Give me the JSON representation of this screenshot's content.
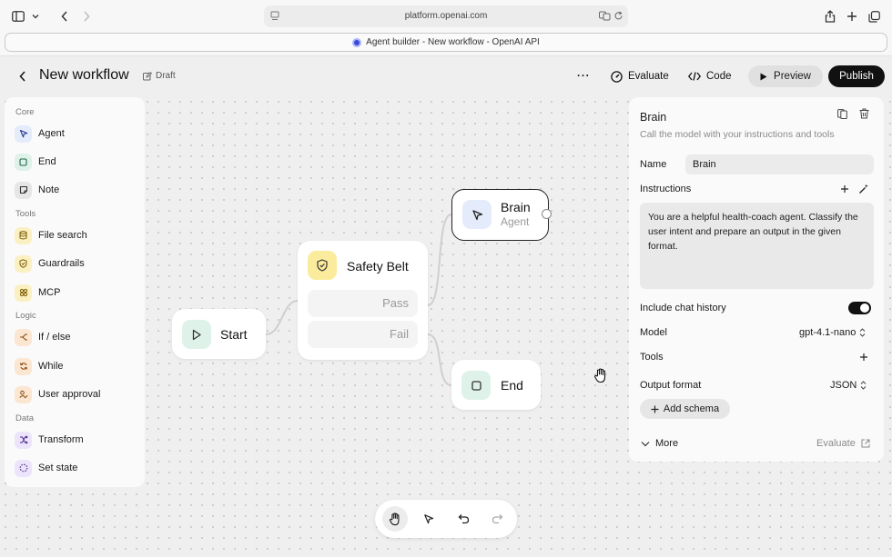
{
  "browser": {
    "url": "platform.openai.com",
    "tab_title": "Agent builder - New workflow - OpenAI API"
  },
  "header": {
    "title": "New workflow",
    "draft_label": "Draft",
    "more_label": "···",
    "evaluate_label": "Evaluate",
    "code_label": "Code",
    "preview_label": "Preview",
    "publish_label": "Publish"
  },
  "palette": {
    "sections": [
      {
        "label": "Core",
        "items": [
          {
            "label": "Agent",
            "icon": "agent-icon",
            "color": "#e4ebfb"
          },
          {
            "label": "End",
            "icon": "end-icon",
            "color": "#dff2ea"
          },
          {
            "label": "Note",
            "icon": "note-icon",
            "color": "#e6e6e6"
          }
        ]
      },
      {
        "label": "Tools",
        "items": [
          {
            "label": "File search",
            "icon": "database-icon",
            "color": "#fbf0c2"
          },
          {
            "label": "Guardrails",
            "icon": "shield-icon",
            "color": "#fbf0c2"
          },
          {
            "label": "MCP",
            "icon": "mcp-icon",
            "color": "#fbf0c2"
          }
        ]
      },
      {
        "label": "Logic",
        "items": [
          {
            "label": "If / else",
            "icon": "branch-icon",
            "color": "#fbe6d2"
          },
          {
            "label": "While",
            "icon": "loop-icon",
            "color": "#fbe6d2"
          },
          {
            "label": "User approval",
            "icon": "approval-icon",
            "color": "#fbe6d2"
          }
        ]
      },
      {
        "label": "Data",
        "items": [
          {
            "label": "Transform",
            "icon": "shuffle-icon",
            "color": "#ece4fb"
          },
          {
            "label": "Set state",
            "icon": "state-icon",
            "color": "#ece4fb"
          }
        ]
      }
    ]
  },
  "nodes": {
    "start": {
      "label": "Start"
    },
    "safety": {
      "label": "Safety Belt",
      "pass": "Pass",
      "fail": "Fail"
    },
    "brain": {
      "label": "Brain",
      "sub": "Agent"
    },
    "end": {
      "label": "End"
    }
  },
  "inspector": {
    "title": "Brain",
    "subtitle": "Call the model with your instructions and tools",
    "name_label": "Name",
    "name_value": "Brain",
    "instructions_label": "Instructions",
    "instructions_text": "You are a helpful health-coach agent. Classify the user intent and prepare an output in the given format.",
    "chat_history_label": "Include chat history",
    "chat_history_on": true,
    "model_label": "Model",
    "model_value": "gpt-4.1-nano",
    "tools_label": "Tools",
    "output_format_label": "Output format",
    "output_format_value": "JSON",
    "add_schema_label": "Add schema",
    "more_label": "More",
    "evaluate_label": "Evaluate"
  },
  "colors": {
    "accent_dark": "#111111",
    "start_icon_bg": "#dff2ea",
    "safety_icon_bg": "#fbec9d",
    "brain_icon_bg": "#e4ebfb",
    "end_icon_bg": "#dff2ea"
  }
}
